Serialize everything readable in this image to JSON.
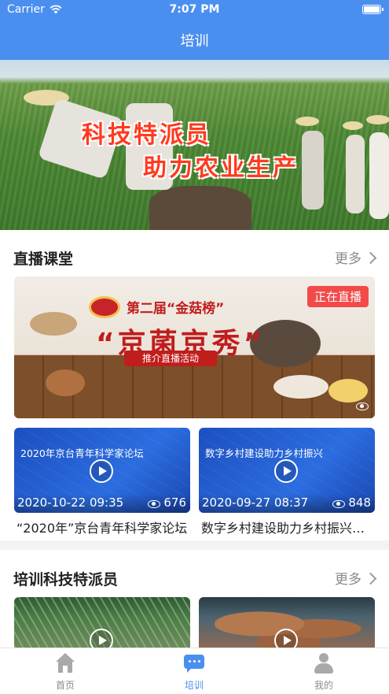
{
  "status_bar": {
    "carrier": "Carrier",
    "time": "7:07 PM"
  },
  "nav": {
    "title": "培训"
  },
  "hero": {
    "line1": "科技特派员",
    "line2": "助力农业生产"
  },
  "live_section": {
    "title": "直播课堂",
    "more": "更多",
    "banner": {
      "title_small": "第二届“金菇榜”",
      "title_big": "“京菌京秀”",
      "subtitle": "推介直播活动",
      "badge": "正在直播"
    },
    "videos": [
      {
        "thumb_title": "2020年京台青年科学家论坛",
        "date": "2020-10-22 09:35",
        "views": "676",
        "caption": "“2020年”京台青年科学家论坛"
      },
      {
        "thumb_title": "数字乡村建设助力乡村振兴",
        "date": "2020-09-27 08:37",
        "views": "848",
        "caption": "数字乡村建设助力乡村振兴高级研修班"
      }
    ]
  },
  "training_section": {
    "title": "培训科技特派员",
    "more": "更多"
  },
  "tabbar": {
    "tabs": [
      {
        "label": "首页",
        "icon": "home-icon",
        "active": false
      },
      {
        "label": "培训",
        "icon": "chat-icon",
        "active": true
      },
      {
        "label": "我的",
        "icon": "person-icon",
        "active": false
      }
    ],
    "active_color": "#4a8ff0",
    "inactive_color": "#8c8c8c"
  },
  "colors": {
    "nav_blue": "#4a8ff0",
    "live_badge": "#f24a4a"
  }
}
